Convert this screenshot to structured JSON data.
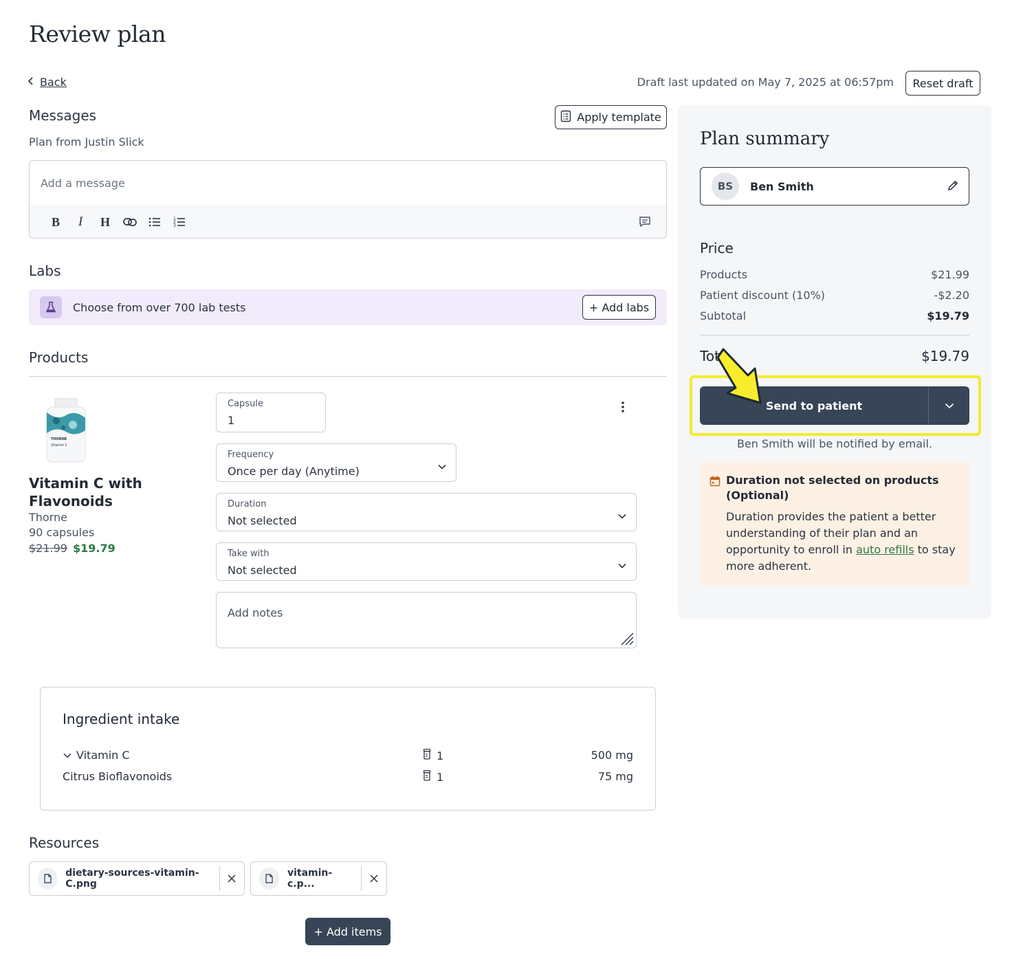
{
  "page": {
    "title": "Review plan",
    "back_label": "Back",
    "draft_info": "Draft last updated on May 7, 2025 at 06:57pm",
    "reset_label": "Reset draft"
  },
  "messages": {
    "heading": "Messages",
    "apply_template_label": "Apply template",
    "plan_from": "Plan from Justin Slick",
    "placeholder": "Add a message",
    "toolbar": [
      "bold",
      "italic",
      "heading",
      "link",
      "bullet-list",
      "numbered-list"
    ]
  },
  "labs": {
    "heading": "Labs",
    "prompt": "Choose from over 700 lab tests",
    "add_label": "+ Add labs"
  },
  "products": {
    "heading": "Products",
    "item": {
      "name": "Vitamin C with Flavonoids",
      "brand": "Thorne",
      "size": "90 capsules",
      "old_price": "$21.99",
      "new_price": "$19.79",
      "image_brand_text": "THORNE",
      "image_product_text": "Vitamin C"
    },
    "fields": {
      "capsule_label": "Capsule",
      "capsule_value": "1",
      "frequency_label": "Frequency",
      "frequency_value": "Once per day (Anytime)",
      "duration_label": "Duration",
      "duration_value": "Not selected",
      "take_with_label": "Take with",
      "take_with_value": "Not selected",
      "notes_placeholder": "Add notes"
    }
  },
  "ingredients": {
    "heading": "Ingredient intake",
    "rows": [
      {
        "name": "Vitamin C",
        "qty": "1",
        "amount": "500 mg"
      },
      {
        "name": "Citrus Bioflavonoids",
        "qty": "1",
        "amount": "75 mg"
      }
    ]
  },
  "resources": {
    "heading": "Resources",
    "files": [
      "dietary-sources-vitamin-C.png",
      "vitamin-c.p..."
    ]
  },
  "add_items_label": "+ Add items",
  "summary": {
    "title": "Plan summary",
    "patient_initials": "BS",
    "patient_name": "Ben Smith",
    "price_heading": "Price",
    "rows": [
      {
        "label": "Products",
        "value": "$21.99"
      },
      {
        "label": "Patient discount (10%)",
        "value": "-$2.20"
      },
      {
        "label": "Subtotal",
        "value": "$19.79"
      }
    ],
    "total_label": "Tot",
    "total_value": "$19.79",
    "send_label": "Send to patient",
    "notify_text": "Ben Smith will be notified by email.",
    "warning": {
      "title": "Duration not selected on products (Optional)",
      "body_pre": "Duration provides the patient a better understanding of their plan and an opportunity to enroll in ",
      "link": "auto refills",
      "body_post": " to stay more adherent."
    }
  },
  "colors": {
    "primary": "#374557",
    "highlight": "#f5ea2e",
    "price_green": "#2d7a45",
    "labs_bg": "#f1ebfb",
    "warning_bg": "#fdf0e4"
  }
}
